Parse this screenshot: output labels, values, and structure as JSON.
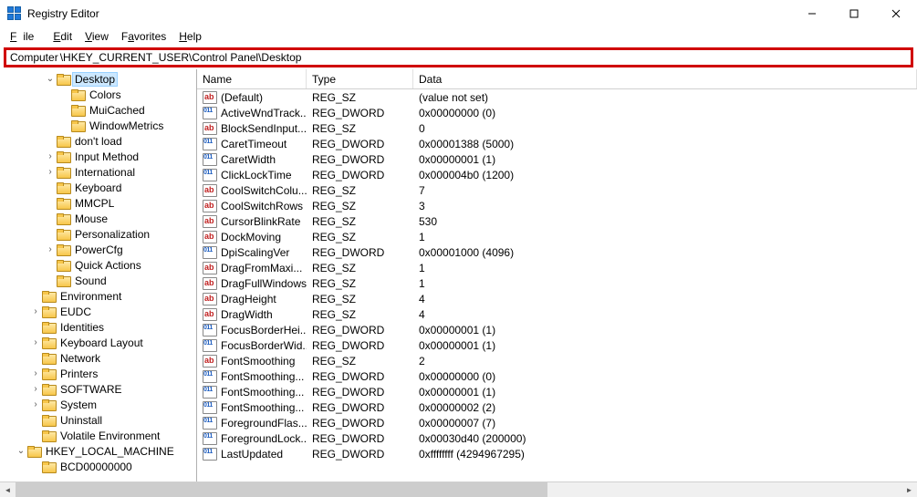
{
  "title": "Registry Editor",
  "menu": {
    "file": "File",
    "edit": "Edit",
    "view": "View",
    "favorites": "Favorites",
    "help": "Help"
  },
  "address": {
    "label": "Computer",
    "path": "\\HKEY_CURRENT_USER\\Control Panel\\Desktop"
  },
  "columns": {
    "name": "Name",
    "type": "Type",
    "data": "Data"
  },
  "tree": [
    {
      "indent": 3,
      "twisty": "open",
      "label": "Desktop",
      "selected": true
    },
    {
      "indent": 4,
      "twisty": "",
      "label": "Colors"
    },
    {
      "indent": 4,
      "twisty": "",
      "label": "MuiCached"
    },
    {
      "indent": 4,
      "twisty": "",
      "label": "WindowMetrics"
    },
    {
      "indent": 3,
      "twisty": "",
      "label": "don't load"
    },
    {
      "indent": 3,
      "twisty": "closed",
      "label": "Input Method"
    },
    {
      "indent": 3,
      "twisty": "closed",
      "label": "International"
    },
    {
      "indent": 3,
      "twisty": "",
      "label": "Keyboard"
    },
    {
      "indent": 3,
      "twisty": "",
      "label": "MMCPL"
    },
    {
      "indent": 3,
      "twisty": "",
      "label": "Mouse"
    },
    {
      "indent": 3,
      "twisty": "",
      "label": "Personalization"
    },
    {
      "indent": 3,
      "twisty": "closed",
      "label": "PowerCfg"
    },
    {
      "indent": 3,
      "twisty": "",
      "label": "Quick Actions"
    },
    {
      "indent": 3,
      "twisty": "",
      "label": "Sound"
    },
    {
      "indent": 2,
      "twisty": "",
      "label": "Environment"
    },
    {
      "indent": 2,
      "twisty": "closed",
      "label": "EUDC"
    },
    {
      "indent": 2,
      "twisty": "",
      "label": "Identities"
    },
    {
      "indent": 2,
      "twisty": "closed",
      "label": "Keyboard Layout"
    },
    {
      "indent": 2,
      "twisty": "",
      "label": "Network"
    },
    {
      "indent": 2,
      "twisty": "closed",
      "label": "Printers"
    },
    {
      "indent": 2,
      "twisty": "closed",
      "label": "SOFTWARE"
    },
    {
      "indent": 2,
      "twisty": "closed",
      "label": "System"
    },
    {
      "indent": 2,
      "twisty": "",
      "label": "Uninstall"
    },
    {
      "indent": 2,
      "twisty": "",
      "label": "Volatile Environment"
    },
    {
      "indent": 1,
      "twisty": "open",
      "label": "HKEY_LOCAL_MACHINE"
    },
    {
      "indent": 2,
      "twisty": "",
      "label": "BCD00000000"
    }
  ],
  "values": [
    {
      "icon": "ab",
      "name": "(Default)",
      "type": "REG_SZ",
      "data": "(value not set)"
    },
    {
      "icon": "bin",
      "name": "ActiveWndTrack...",
      "type": "REG_DWORD",
      "data": "0x00000000 (0)"
    },
    {
      "icon": "ab",
      "name": "BlockSendInput...",
      "type": "REG_SZ",
      "data": "0"
    },
    {
      "icon": "bin",
      "name": "CaretTimeout",
      "type": "REG_DWORD",
      "data": "0x00001388 (5000)"
    },
    {
      "icon": "bin",
      "name": "CaretWidth",
      "type": "REG_DWORD",
      "data": "0x00000001 (1)"
    },
    {
      "icon": "bin",
      "name": "ClickLockTime",
      "type": "REG_DWORD",
      "data": "0x000004b0 (1200)"
    },
    {
      "icon": "ab",
      "name": "CoolSwitchColu...",
      "type": "REG_SZ",
      "data": "7"
    },
    {
      "icon": "ab",
      "name": "CoolSwitchRows",
      "type": "REG_SZ",
      "data": "3"
    },
    {
      "icon": "ab",
      "name": "CursorBlinkRate",
      "type": "REG_SZ",
      "data": "530"
    },
    {
      "icon": "ab",
      "name": "DockMoving",
      "type": "REG_SZ",
      "data": "1"
    },
    {
      "icon": "bin",
      "name": "DpiScalingVer",
      "type": "REG_DWORD",
      "data": "0x00001000 (4096)"
    },
    {
      "icon": "ab",
      "name": "DragFromMaxi...",
      "type": "REG_SZ",
      "data": "1"
    },
    {
      "icon": "ab",
      "name": "DragFullWindows",
      "type": "REG_SZ",
      "data": "1"
    },
    {
      "icon": "ab",
      "name": "DragHeight",
      "type": "REG_SZ",
      "data": "4"
    },
    {
      "icon": "ab",
      "name": "DragWidth",
      "type": "REG_SZ",
      "data": "4"
    },
    {
      "icon": "bin",
      "name": "FocusBorderHei...",
      "type": "REG_DWORD",
      "data": "0x00000001 (1)"
    },
    {
      "icon": "bin",
      "name": "FocusBorderWid...",
      "type": "REG_DWORD",
      "data": "0x00000001 (1)"
    },
    {
      "icon": "ab",
      "name": "FontSmoothing",
      "type": "REG_SZ",
      "data": "2"
    },
    {
      "icon": "bin",
      "name": "FontSmoothing...",
      "type": "REG_DWORD",
      "data": "0x00000000 (0)"
    },
    {
      "icon": "bin",
      "name": "FontSmoothing...",
      "type": "REG_DWORD",
      "data": "0x00000001 (1)"
    },
    {
      "icon": "bin",
      "name": "FontSmoothing...",
      "type": "REG_DWORD",
      "data": "0x00000002 (2)"
    },
    {
      "icon": "bin",
      "name": "ForegroundFlas...",
      "type": "REG_DWORD",
      "data": "0x00000007 (7)"
    },
    {
      "icon": "bin",
      "name": "ForegroundLock...",
      "type": "REG_DWORD",
      "data": "0x00030d40 (200000)"
    },
    {
      "icon": "bin",
      "name": "LastUpdated",
      "type": "REG_DWORD",
      "data": "0xffffffff (4294967295)"
    }
  ]
}
